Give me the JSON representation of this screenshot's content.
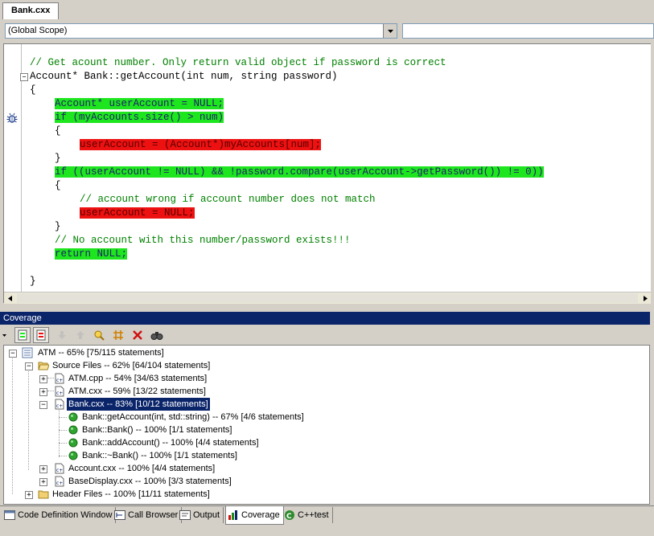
{
  "document": {
    "tab_label": "Bank.cxx"
  },
  "scope_bar": {
    "scope_value": "(Global Scope)",
    "member_value": ""
  },
  "code": {
    "lines": [
      {
        "text": "// Get acount number. Only return valid object if password is correct",
        "kind": "comment"
      },
      {
        "text": "Account* Bank::getAccount(int num, string password)",
        "kind": "plain"
      },
      {
        "text": "{",
        "kind": "plain"
      },
      {
        "text": "Account* userAccount = NULL;",
        "kind": "covered"
      },
      {
        "text": "if (myAccounts.size() > num)",
        "kind": "covered"
      },
      {
        "text": "{",
        "kind": "plain"
      },
      {
        "text": "userAccount = (Account*)myAccounts[num];",
        "kind": "uncovered"
      },
      {
        "text": "}",
        "kind": "plain"
      },
      {
        "text": "if ((userAccount != NULL) && !password.compare(userAccount->getPassword()) != 0))",
        "kind": "covered"
      },
      {
        "text": "{",
        "kind": "plain"
      },
      {
        "text": "// account wrong if account number does not match",
        "kind": "comment"
      },
      {
        "text": "userAccount = NULL;",
        "kind": "uncovered"
      },
      {
        "text": "}",
        "kind": "plain"
      },
      {
        "text": "// No account with this number/password exists!!!",
        "kind": "comment"
      },
      {
        "text": "return NULL;",
        "kind": "covered"
      },
      {
        "text": "",
        "kind": "plain"
      },
      {
        "text": "}",
        "kind": "plain"
      }
    ]
  },
  "coverage": {
    "title": "Coverage",
    "toolbar": [
      "dropdown-arrow-icon",
      "show-coverage-icon",
      "hide-coverage-icon",
      "move-down-icon",
      "move-up-icon",
      "find-icon",
      "expand-icon",
      "clear-icon",
      "search-icon"
    ],
    "tree": {
      "root": "ATM -- 65% [75/115 statements]",
      "source_files": "Source Files -- 62% [64/104 statements]",
      "atm_cpp": "ATM.cpp -- 54% [34/63 statements]",
      "atm_cxx": "ATM.cxx -- 59% [13/22 statements]",
      "bank_cxx": "Bank.cxx -- 83% [10/12 statements]",
      "bank_methods": [
        "Bank::getAccount(int, std::string) -- 67% [4/6 statements]",
        "Bank::Bank() -- 100% [1/1 statements]",
        "Bank::addAccount() -- 100% [4/4 statements]",
        "Bank::~Bank() -- 100% [1/1 statements]"
      ],
      "account_cxx": "Account.cxx -- 100% [4/4 statements]",
      "basedisplay_cxx": "BaseDisplay.cxx -- 100% [3/3 statements]",
      "header_files": "Header Files -- 100% [11/11 statements]"
    }
  },
  "bottom_tabs": [
    {
      "label": "Code Definition Window",
      "active": false
    },
    {
      "label": "Call Browser",
      "active": false
    },
    {
      "label": "Output",
      "active": false
    },
    {
      "label": "Coverage",
      "active": true
    },
    {
      "label": "C++test",
      "active": false
    }
  ],
  "colors": {
    "covered": "#1ee61e",
    "uncovered": "#ee1111",
    "selection": "#0a246a"
  }
}
